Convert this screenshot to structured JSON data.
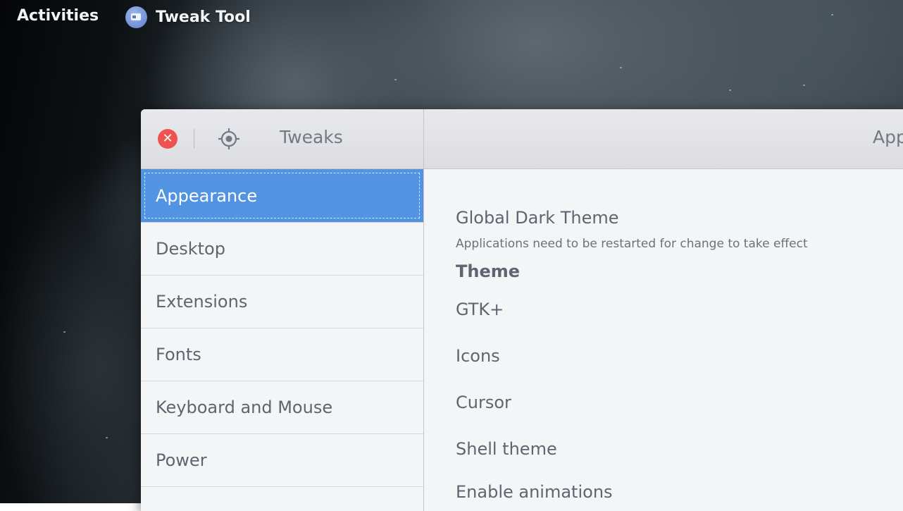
{
  "topbar": {
    "activities_label": "Activities",
    "app_name": "Tweak Tool",
    "app_icon": "tweak-tool-icon"
  },
  "window": {
    "header_left_title": "Tweaks",
    "header_right_title": "Appearance",
    "close_icon": "close-icon",
    "locate_icon": "crosshair-icon"
  },
  "sidebar": {
    "items": [
      {
        "label": "Appearance",
        "selected": true
      },
      {
        "label": "Desktop"
      },
      {
        "label": "Extensions"
      },
      {
        "label": "Fonts"
      },
      {
        "label": "Keyboard and Mouse"
      },
      {
        "label": "Power"
      }
    ]
  },
  "content": {
    "global_dark_theme": {
      "title": "Global Dark Theme",
      "subtitle": "Applications need to be restarted for change to take effect"
    },
    "theme_section": "Theme",
    "rows": [
      {
        "label": "GTK+"
      },
      {
        "label": "Icons"
      },
      {
        "label": "Cursor"
      },
      {
        "label": "Shell theme"
      },
      {
        "label": "Enable animations"
      }
    ]
  },
  "colors": {
    "accent": "#5294e2",
    "close": "#ef5350"
  }
}
